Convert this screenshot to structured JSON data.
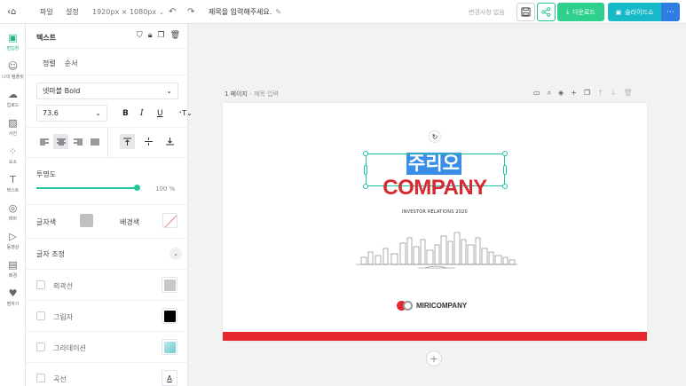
{
  "topbar": {
    "back_icon": "‹⌂",
    "menu": [
      "파일",
      "설정"
    ],
    "canvas_size": "1920px × 1080px",
    "undo": "↶",
    "redo": "↷",
    "doc_title": "제목을 입력해주세요.",
    "saved_status": "변경사항 없음",
    "download_label": "다운로드",
    "slideshow_label": "슬라이드쇼",
    "more_label": "⋯"
  },
  "leftnav": [
    {
      "label": "편집창",
      "icon": "layout-icon",
      "glyph": "▣",
      "active": true
    },
    {
      "label": "나의 템플릿",
      "icon": "user-icon",
      "glyph": "☺",
      "active": false
    },
    {
      "label": "업로드",
      "icon": "cloud-upload-icon",
      "glyph": "☁",
      "active": false
    },
    {
      "label": "사진",
      "icon": "image-icon",
      "glyph": "▨",
      "active": false
    },
    {
      "label": "요소",
      "icon": "elements-icon",
      "glyph": "⁘",
      "active": false
    },
    {
      "label": "텍스트",
      "icon": "text-icon",
      "glyph": "T",
      "active": false
    },
    {
      "label": "테마",
      "icon": "palette-icon",
      "glyph": "◎",
      "active": false
    },
    {
      "label": "동영상",
      "icon": "video-icon",
      "glyph": "▷",
      "active": false
    },
    {
      "label": "배경",
      "icon": "background-icon",
      "glyph": "▤",
      "active": false
    },
    {
      "label": "찜하기",
      "icon": "heart-icon",
      "glyph": "♥",
      "active": false
    }
  ],
  "panel": {
    "title": "텍스트",
    "tabs": [
      "정렬",
      "순서"
    ],
    "font_family": "넷마블 Bold",
    "font_size": "73.6",
    "format": {
      "bold": "B",
      "italic": "I",
      "underline": "U",
      "spacing": "⁺T"
    },
    "opacity_label": "투명도",
    "opacity_value": "100 %",
    "opacity": 1.0,
    "text_color_label": "글자색",
    "text_color": "#c0c0c0",
    "bg_color_label": "배경색",
    "adjust_label": "글자 조정",
    "options": [
      {
        "label": "외곽선",
        "swatch": "#c8c8c8"
      },
      {
        "label": "그림자",
        "swatch": "#000000"
      },
      {
        "label": "그라데이션",
        "swatch": "#7fd3d6"
      },
      {
        "label": "곡선",
        "swatch": "A"
      }
    ]
  },
  "canvas": {
    "page_label": "1 페이지",
    "page_sub": "- 제목 입력",
    "headline": "주리오",
    "company": "COMPANY",
    "subtitle": "INVESTOR RELATIONS 2020",
    "logo_name": "MIRICOMPANY",
    "accent": "#e4282e",
    "selection_color": "#21c1a6",
    "highlight": "#3a8ee8",
    "add_page": "+"
  }
}
